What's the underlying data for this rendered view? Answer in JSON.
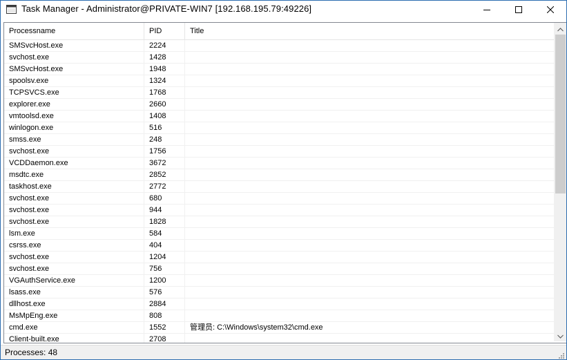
{
  "window": {
    "title": "Task Manager - Administrator@PRIVATE-WIN7 [192.168.195.79:49226]"
  },
  "icons": {
    "app": "app-window-icon",
    "minimize": "minimize-icon",
    "maximize": "maximize-icon",
    "close": "close-icon",
    "scroll_up": "chevron-up-icon",
    "scroll_down": "chevron-down-icon",
    "grip": "resize-grip-icon"
  },
  "columns": {
    "name": "Processname",
    "pid": "PID",
    "title": "Title"
  },
  "processes": [
    {
      "name": "SMSvcHost.exe",
      "pid": "2224",
      "title": ""
    },
    {
      "name": "svchost.exe",
      "pid": "1428",
      "title": ""
    },
    {
      "name": "SMSvcHost.exe",
      "pid": "1948",
      "title": ""
    },
    {
      "name": "spoolsv.exe",
      "pid": "1324",
      "title": ""
    },
    {
      "name": "TCPSVCS.exe",
      "pid": "1768",
      "title": ""
    },
    {
      "name": "explorer.exe",
      "pid": "2660",
      "title": ""
    },
    {
      "name": "vmtoolsd.exe",
      "pid": "1408",
      "title": ""
    },
    {
      "name": "winlogon.exe",
      "pid": "516",
      "title": ""
    },
    {
      "name": "smss.exe",
      "pid": "248",
      "title": ""
    },
    {
      "name": "svchost.exe",
      "pid": "1756",
      "title": ""
    },
    {
      "name": "VCDDaemon.exe",
      "pid": "3672",
      "title": ""
    },
    {
      "name": "msdtc.exe",
      "pid": "2852",
      "title": ""
    },
    {
      "name": "taskhost.exe",
      "pid": "2772",
      "title": ""
    },
    {
      "name": "svchost.exe",
      "pid": "680",
      "title": ""
    },
    {
      "name": "svchost.exe",
      "pid": "944",
      "title": ""
    },
    {
      "name": "svchost.exe",
      "pid": "1828",
      "title": ""
    },
    {
      "name": "lsm.exe",
      "pid": "584",
      "title": ""
    },
    {
      "name": "csrss.exe",
      "pid": "404",
      "title": ""
    },
    {
      "name": "svchost.exe",
      "pid": "1204",
      "title": ""
    },
    {
      "name": "svchost.exe",
      "pid": "756",
      "title": ""
    },
    {
      "name": "VGAuthService.exe",
      "pid": "1200",
      "title": ""
    },
    {
      "name": "lsass.exe",
      "pid": "576",
      "title": ""
    },
    {
      "name": "dllhost.exe",
      "pid": "2884",
      "title": ""
    },
    {
      "name": "MsMpEng.exe",
      "pid": "808",
      "title": ""
    },
    {
      "name": "cmd.exe",
      "pid": "1552",
      "title": "管理员: C:\\Windows\\system32\\cmd.exe"
    },
    {
      "name": "Client-built.exe",
      "pid": "2708",
      "title": ""
    }
  ],
  "status": {
    "processes": "Processes: 48"
  }
}
